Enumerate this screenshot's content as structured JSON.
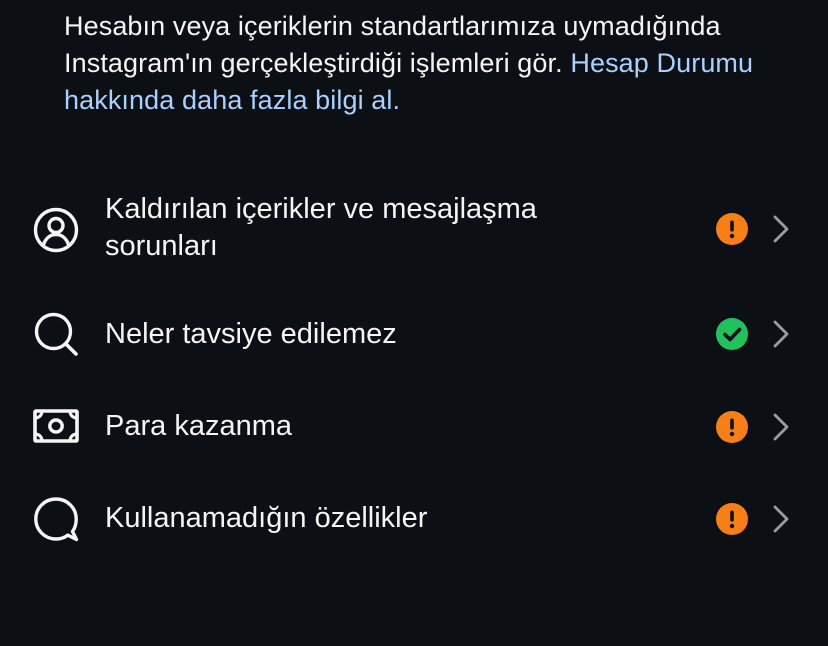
{
  "intro": {
    "text": "Hesabın veya içeriklerin standartlarımıza uymadığında Instagram'ın gerçekleştirdiği işlemleri gör.",
    "link": "Hesap Durumu hakkında daha fazla bilgi al."
  },
  "items": [
    {
      "label": "Kaldırılan içerikler ve mesajlaşma sorunları",
      "icon": "user-circle-icon",
      "status": "warning",
      "status_color": "#f77f14"
    },
    {
      "label": "Neler tavsiye edilemez",
      "icon": "search-icon",
      "status": "ok",
      "status_color": "#1fc25b"
    },
    {
      "label": "Para kazanma",
      "icon": "money-icon",
      "status": "warning",
      "status_color": "#f77f14"
    },
    {
      "label": "Kullanamadığın özellikler",
      "icon": "chat-bubble-icon",
      "status": "warning",
      "status_color": "#f77f14"
    }
  ]
}
